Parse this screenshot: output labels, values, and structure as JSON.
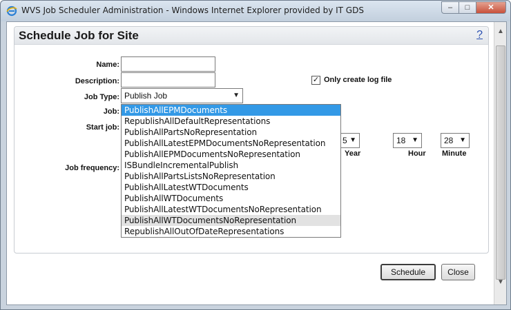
{
  "window": {
    "title": "WVS Job Scheduler Administration - Windows Internet Explorer provided by IT GDS",
    "minimize_glyph": "–",
    "maximize_glyph": "□",
    "close_glyph": "✕"
  },
  "page": {
    "title": "Schedule Job for Site",
    "help_label": "?"
  },
  "form": {
    "name_label": "Name:",
    "name_value": "",
    "description_label": "Description:",
    "description_value": "",
    "only_log_label": "Only create log file",
    "only_log_checked": true,
    "job_type_label": "Job Type:",
    "job_type_value": "Publish Job",
    "job_label": "Job:",
    "start_job_label": "Start job:",
    "job_frequency_label": "Job frequency:",
    "year_value": "5",
    "year_label": "Year",
    "hour_value": "18",
    "hour_label": "Hour",
    "minute_value": "28",
    "minute_label": "Minute"
  },
  "job_options": [
    "PublishAllEPMDocuments",
    "RepublishAllDefaultRepresentations",
    "PublishAllPartsNoRepresentation",
    "PublishAllLatestEPMDocumentsNoRepresentation",
    "PublishAllEPMDocumentsNoRepresentation",
    "ISBundleIncrementalPublish",
    "PublishAllPartsListsNoRepresentation",
    "PublishAllLatestWTDocuments",
    "PublishAllWTDocuments",
    "PublishAllLatestWTDocumentsNoRepresentation",
    "PublishAllWTDocumentsNoRepresentation",
    "RepublishAllOutOfDateRepresentations"
  ],
  "selected_option_index": 0,
  "hovered_option_index": 10,
  "buttons": {
    "schedule": "Schedule",
    "close": "Close"
  },
  "colors": {
    "selected_highlight": "#3399e6",
    "link": "#2a4fb0"
  }
}
